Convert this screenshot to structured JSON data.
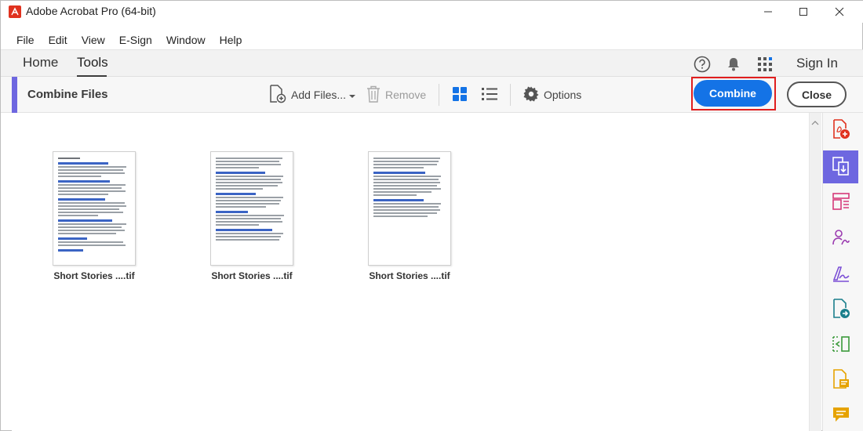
{
  "window": {
    "title": "Adobe Acrobat Pro (64-bit)"
  },
  "menu": [
    "File",
    "Edit",
    "View",
    "E-Sign",
    "Window",
    "Help"
  ],
  "nav": {
    "home": "Home",
    "tools": "Tools",
    "sign_in": "Sign In",
    "active_tab": "Tools"
  },
  "toolbar": {
    "title": "Combine Files",
    "add_files": "Add Files...",
    "remove": "Remove",
    "options": "Options",
    "combine": "Combine",
    "close": "Close"
  },
  "files": [
    {
      "name": "Short Stories ....tif"
    },
    {
      "name": "Short Stories ....tif"
    },
    {
      "name": "Short Stories ....tif"
    }
  ],
  "rail": [
    "create-pdf-icon",
    "combine-files-icon",
    "organize-pages-icon",
    "request-signature-icon",
    "fill-sign-icon",
    "export-pdf-icon",
    "compare-icon",
    "edit-pdf-icon",
    "comment-icon"
  ],
  "colors": {
    "accent": "#6e67e0",
    "primary": "#1473e6",
    "highlight": "#e01e1e",
    "brand": "#e0321f"
  }
}
